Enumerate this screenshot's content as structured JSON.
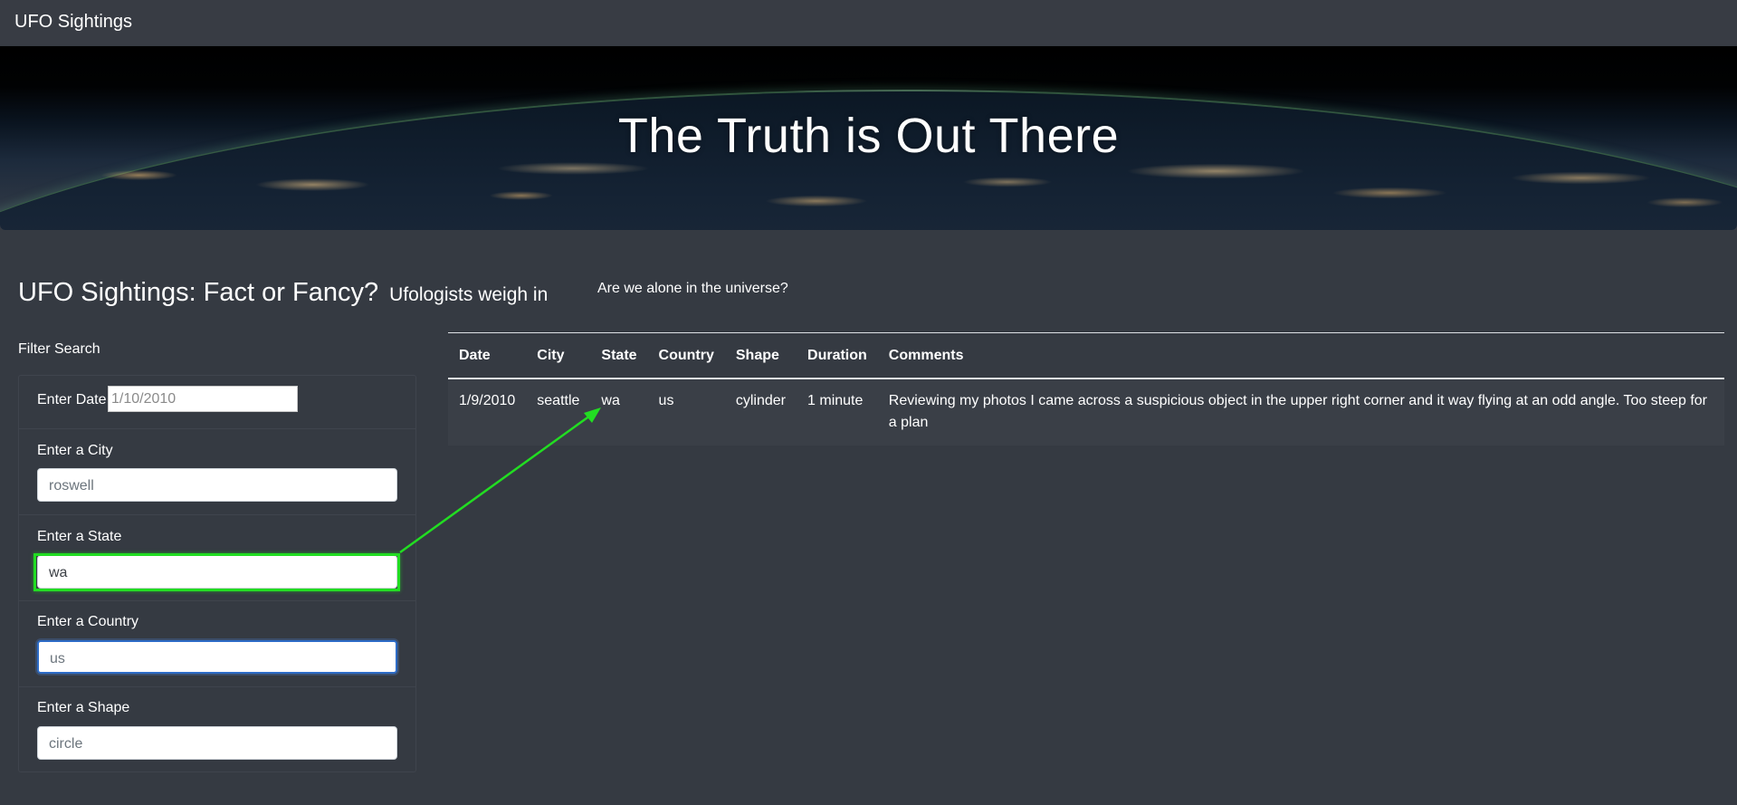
{
  "navbar": {
    "brand": "UFO Sightings"
  },
  "hero": {
    "title": "The Truth is Out There"
  },
  "article": {
    "title": "UFO Sightings: Fact or Fancy?",
    "subtitle": "Ufologists weigh in",
    "tagline": "Are we alone in the universe?"
  },
  "filters": {
    "heading": "Filter Search",
    "date": {
      "label": "Enter Date",
      "placeholder": "1/10/2010",
      "value": ""
    },
    "city": {
      "label": "Enter a City",
      "placeholder": "roswell",
      "value": ""
    },
    "state": {
      "label": "Enter a State",
      "placeholder": "",
      "value": "wa"
    },
    "country": {
      "label": "Enter a Country",
      "placeholder": "us",
      "value": ""
    },
    "shape": {
      "label": "Enter a Shape",
      "placeholder": "circle",
      "value": ""
    }
  },
  "table": {
    "headers": [
      "Date",
      "City",
      "State",
      "Country",
      "Shape",
      "Duration",
      "Comments"
    ],
    "rows": [
      {
        "date": "1/9/2010",
        "city": "seattle",
        "state": "wa",
        "country": "us",
        "shape": "cylinder",
        "duration": "1 minute",
        "comments": "Reviewing my photos I came across a suspicious object in the upper right corner and it way flying at an odd angle. Too steep for a plan"
      }
    ]
  },
  "colors": {
    "background": "#353a42",
    "highlight": "#22dd22",
    "focus": "#2d6cc7"
  }
}
